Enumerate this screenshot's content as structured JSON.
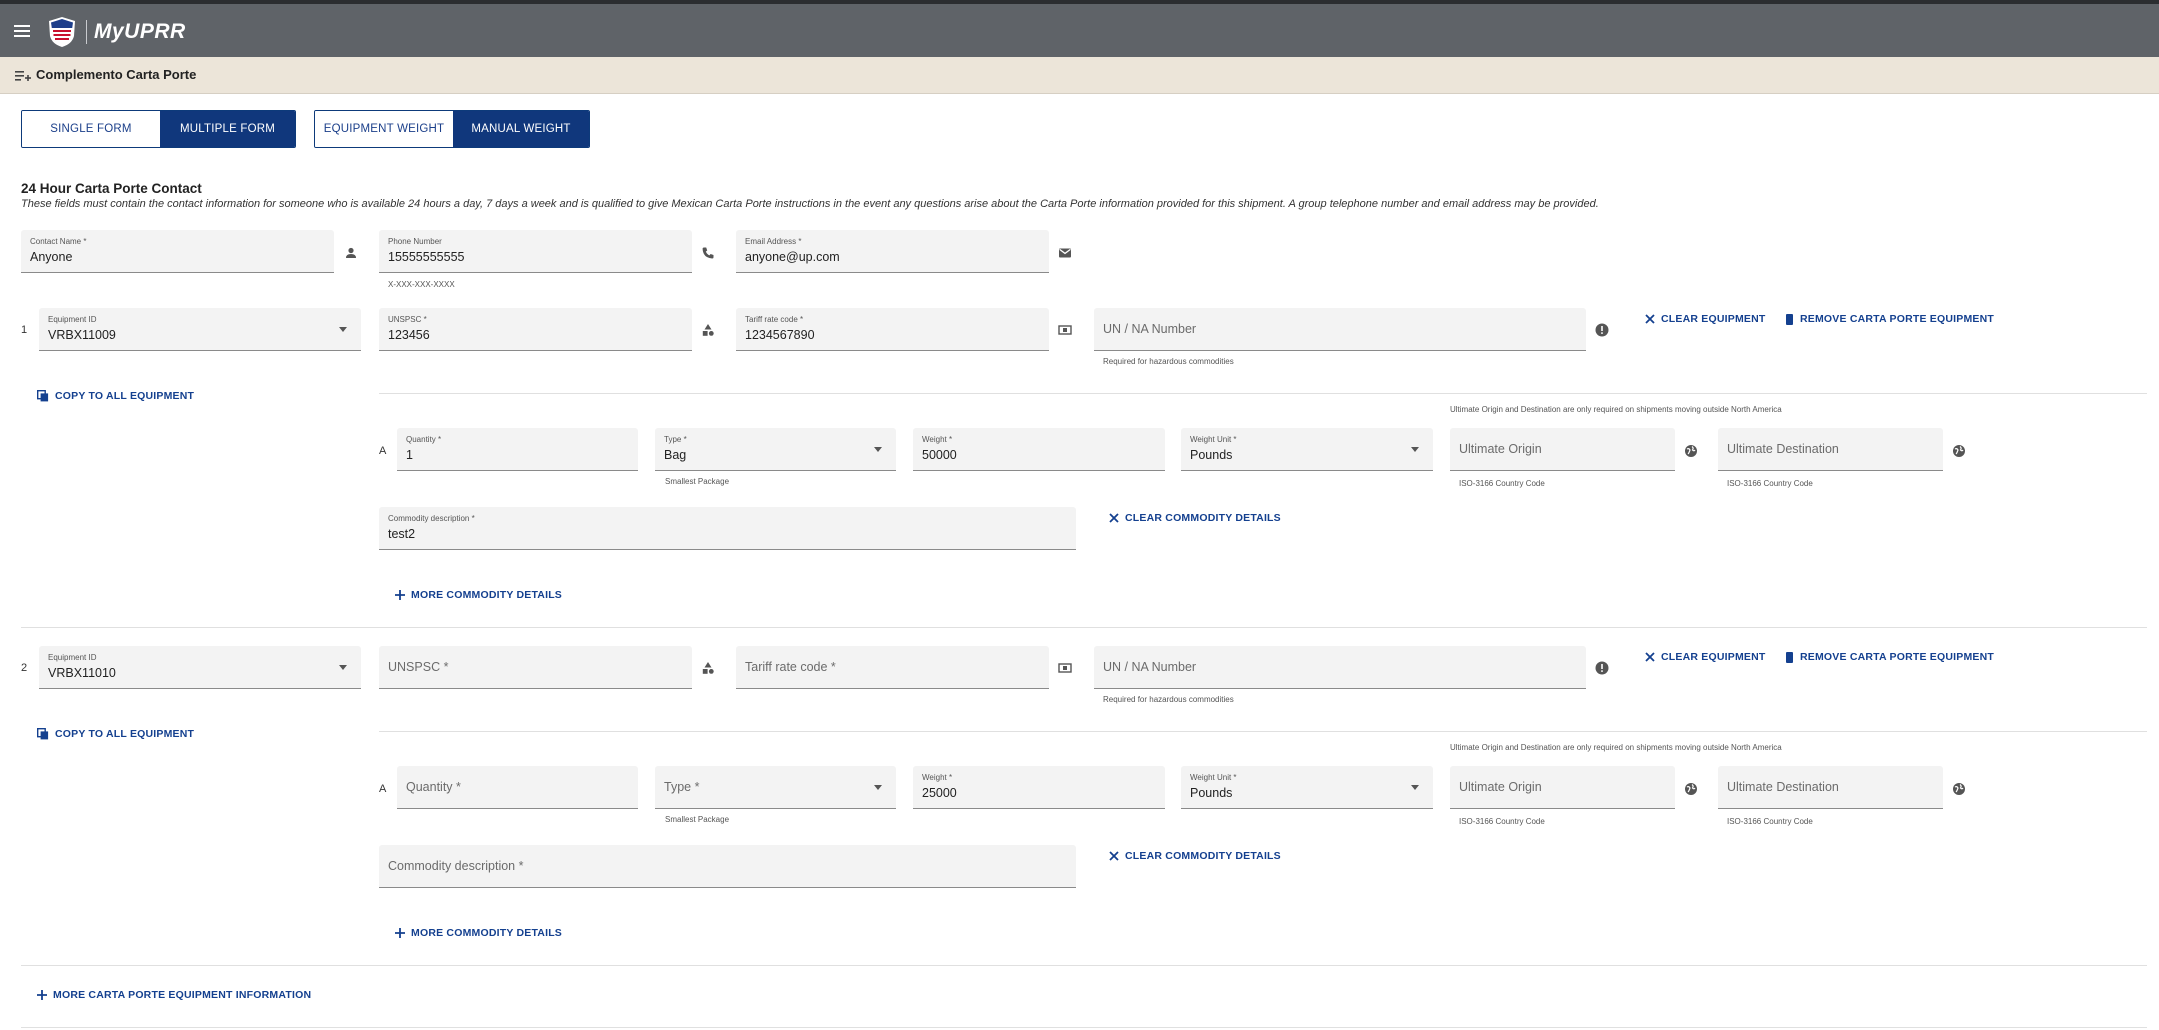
{
  "app": {
    "brand": "MyUPRR",
    "page_title": "Complemento Carta Porte"
  },
  "mode_toggle": {
    "single": "SINGLE FORM",
    "multiple": "MULTIPLE FORM",
    "selected": "MULTIPLE FORM"
  },
  "weight_toggle": {
    "equipment": "EQUIPMENT WEIGHT",
    "manual": "MANUAL WEIGHT",
    "selected": "MANUAL WEIGHT"
  },
  "contact": {
    "heading": "24 Hour Carta Porte Contact",
    "description": "These fields must contain the contact information for someone who is available 24 hours a day, 7 days a week and is qualified to give Mexican Carta Porte instructions in the event any questions arise about the Carta Porte information provided for this shipment. A group telephone number and email address may be provided.",
    "name_label": "Contact Name *",
    "name_value": "Anyone",
    "phone_label": "Phone Number",
    "phone_value": "15555555555",
    "phone_hint": "X-XXX-XXX-XXXX",
    "email_label": "Email Address *",
    "email_value": "anyone@up.com"
  },
  "labels": {
    "equipment_id": "Equipment ID",
    "unspsc": "UNSPSC *",
    "tariff": "Tariff rate code *",
    "un_na": "UN / NA Number",
    "un_hint": "Required for hazardous commodities",
    "clear_equipment": "CLEAR EQUIPMENT",
    "remove_equipment": "REMOVE CARTA PORTE EQUIPMENT",
    "copy_all": "COPY TO ALL EQUIPMENT",
    "ultimate_note": "Ultimate Origin and Destination are only required on shipments moving outside North America",
    "quantity": "Quantity *",
    "type": "Type *",
    "type_hint": "Smallest Package",
    "weight": "Weight *",
    "weight_unit": "Weight Unit *",
    "ultimate_origin": "Ultimate Origin",
    "ultimate_destination": "Ultimate Destination",
    "iso_hint": "ISO-3166 Country Code",
    "commodity_desc": "Commodity description *",
    "clear_commodity": "CLEAR COMMODITY DETAILS",
    "more_commodity": "MORE COMMODITY DETAILS",
    "more_equipment": "MORE CARTA PORTE EQUIPMENT INFORMATION"
  },
  "equipment": [
    {
      "index": "1",
      "equipment_id": "VRBX11009",
      "unspsc": "123456",
      "tariff": "1234567890",
      "commodity_letter": "A",
      "quantity": "1",
      "type": "Bag",
      "weight": "50000",
      "weight_unit": "Pounds",
      "commodity_desc": "test2"
    },
    {
      "index": "2",
      "equipment_id": "VRBX11010",
      "unspsc": "",
      "tariff": "",
      "commodity_letter": "A",
      "quantity": "",
      "type": "",
      "weight": "25000",
      "weight_unit": "Pounds",
      "commodity_desc": ""
    }
  ]
}
